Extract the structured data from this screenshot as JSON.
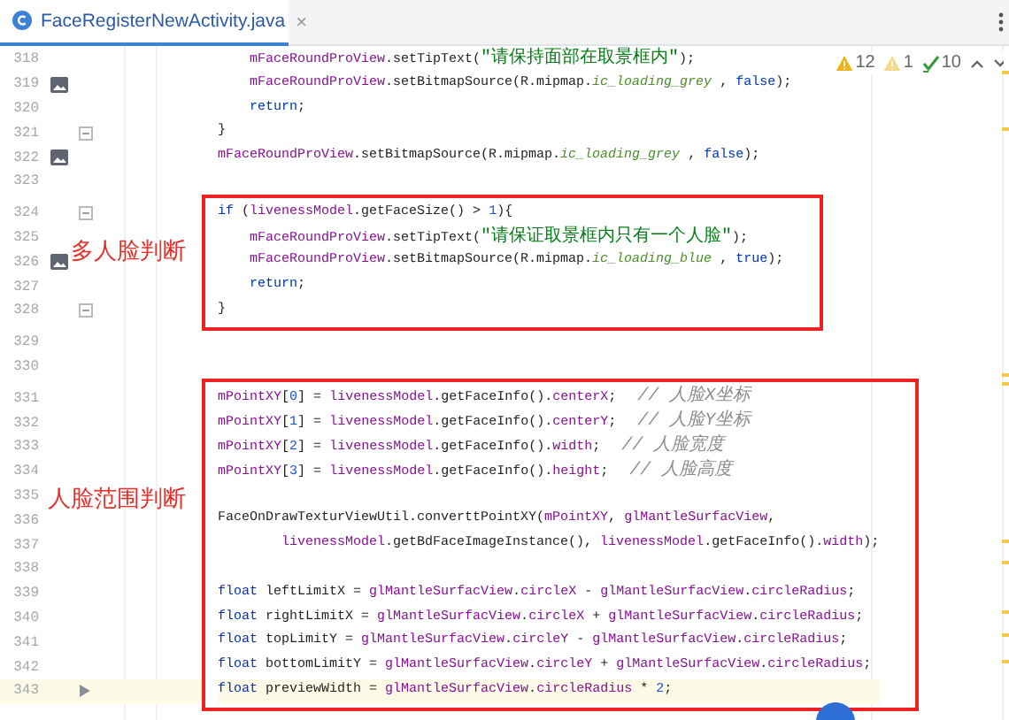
{
  "tab": {
    "title": "FaceRegisterNewActivity.java",
    "selected": true,
    "close": "×"
  },
  "inspections": [
    {
      "kind": "warning",
      "count": "12"
    },
    {
      "kind": "weak",
      "count": "1"
    },
    {
      "kind": "ok",
      "count": "10"
    }
  ],
  "blocks": [
    {
      "lines": [
        {
          "number": "318",
          "indented": true,
          "tokens": [
            {
              "kind": "field",
              "text": "mFaceRoundProView"
            },
            {
              "kind": "plain",
              "text": ".setTipText("
            },
            {
              "kind": "string",
              "text": "\"请保持面部在取景框内\""
            },
            {
              "kind": "plain",
              "text": ");"
            }
          ]
        },
        {
          "number": "319",
          "image_icon": true,
          "indented": true,
          "tokens": [
            {
              "kind": "field",
              "text": "mFaceRoundProView"
            },
            {
              "kind": "plain",
              "text": ".setBitmapSource(R.mipmap."
            },
            {
              "kind": "static",
              "text": "ic_loading_grey"
            },
            {
              "kind": "plain",
              "text": " , "
            },
            {
              "kind": "keyword",
              "text": "false"
            },
            {
              "kind": "plain",
              "text": ");"
            }
          ]
        },
        {
          "number": "320",
          "indented": true,
          "tokens": [
            {
              "kind": "keyword",
              "text": "return"
            },
            {
              "kind": "plain",
              "text": ";"
            }
          ]
        },
        {
          "number": "321",
          "fold": true,
          "tokens": [
            {
              "kind": "plain",
              "text": "}"
            }
          ]
        },
        {
          "number": "322",
          "image_icon": true,
          "tokens": [
            {
              "kind": "field",
              "text": "mFaceRoundProView"
            },
            {
              "kind": "plain",
              "text": ".setBitmapSource(R.mipmap."
            },
            {
              "kind": "static",
              "text": "ic_loading_grey"
            },
            {
              "kind": "plain",
              "text": " , "
            },
            {
              "kind": "keyword",
              "text": "false"
            },
            {
              "kind": "plain",
              "text": ");"
            }
          ]
        },
        {
          "number": "323"
        }
      ]
    },
    {
      "boxed": true,
      "note": "多人脸判断",
      "lines": [
        {
          "number": "324",
          "fold": true,
          "tokens": [
            {
              "kind": "keyword",
              "text": "if"
            },
            {
              "kind": "plain",
              "text": " ("
            },
            {
              "kind": "field",
              "text": "livenessModel"
            },
            {
              "kind": "plain",
              "text": ".getFaceSize() > "
            },
            {
              "kind": "number",
              "text": "1"
            },
            {
              "kind": "plain",
              "text": "){"
            }
          ]
        },
        {
          "number": "325",
          "indented": true,
          "tokens": [
            {
              "kind": "field",
              "text": "mFaceRoundProView"
            },
            {
              "kind": "plain",
              "text": ".setTipText("
            },
            {
              "kind": "string",
              "text": "\"请保证取景框内只有一个人脸\""
            },
            {
              "kind": "plain",
              "text": ");"
            }
          ]
        },
        {
          "number": "326",
          "image_icon": true,
          "indented": true,
          "tokens": [
            {
              "kind": "field",
              "text": "mFaceRoundProView"
            },
            {
              "kind": "plain",
              "text": ".setBitmapSource(R.mipmap."
            },
            {
              "kind": "static",
              "text": "ic_loading_blue"
            },
            {
              "kind": "plain",
              "text": " , "
            },
            {
              "kind": "keyword",
              "text": "true"
            },
            {
              "kind": "plain",
              "text": ");"
            }
          ]
        },
        {
          "number": "327",
          "indented": true,
          "tokens": [
            {
              "kind": "keyword",
              "text": "return"
            },
            {
              "kind": "plain",
              "text": ";"
            }
          ]
        },
        {
          "number": "328",
          "fold": true,
          "tokens": [
            {
              "kind": "plain",
              "text": "}"
            }
          ]
        }
      ]
    },
    {
      "lines": [
        {
          "number": "329"
        },
        {
          "number": "330"
        }
      ]
    },
    {
      "boxed": true,
      "note": "人脸范围判断",
      "lines": [
        {
          "number": "331",
          "tokens": [
            {
              "kind": "field",
              "text": "mPointXY"
            },
            {
              "kind": "plain",
              "text": "["
            },
            {
              "kind": "number",
              "text": "0"
            },
            {
              "kind": "plain",
              "text": "] = "
            },
            {
              "kind": "field",
              "text": "livenessModel"
            },
            {
              "kind": "plain",
              "text": ".getFaceInfo()."
            },
            {
              "kind": "field",
              "text": "centerX"
            },
            {
              "kind": "plain",
              "text": ";"
            },
            {
              "kind": "comment",
              "text": "// 人脸X坐标"
            }
          ]
        },
        {
          "number": "332",
          "tokens": [
            {
              "kind": "field",
              "text": "mPointXY"
            },
            {
              "kind": "plain",
              "text": "["
            },
            {
              "kind": "number",
              "text": "1"
            },
            {
              "kind": "plain",
              "text": "] = "
            },
            {
              "kind": "field",
              "text": "livenessModel"
            },
            {
              "kind": "plain",
              "text": ".getFaceInfo()."
            },
            {
              "kind": "field",
              "text": "centerY"
            },
            {
              "kind": "plain",
              "text": ";"
            },
            {
              "kind": "comment",
              "text": "// 人脸Y坐标"
            }
          ]
        },
        {
          "number": "333",
          "tokens": [
            {
              "kind": "field",
              "text": "mPointXY"
            },
            {
              "kind": "plain",
              "text": "["
            },
            {
              "kind": "number",
              "text": "2"
            },
            {
              "kind": "plain",
              "text": "] = "
            },
            {
              "kind": "field",
              "text": "livenessModel"
            },
            {
              "kind": "plain",
              "text": ".getFaceInfo()."
            },
            {
              "kind": "field",
              "text": "width"
            },
            {
              "kind": "plain",
              "text": ";"
            },
            {
              "kind": "comment",
              "text": "// 人脸宽度"
            }
          ]
        },
        {
          "number": "334",
          "tokens": [
            {
              "kind": "field",
              "text": "mPointXY"
            },
            {
              "kind": "plain",
              "text": "["
            },
            {
              "kind": "number",
              "text": "3"
            },
            {
              "kind": "plain",
              "text": "] = "
            },
            {
              "kind": "field",
              "text": "livenessModel"
            },
            {
              "kind": "plain",
              "text": ".getFaceInfo()."
            },
            {
              "kind": "field",
              "text": "height"
            },
            {
              "kind": "plain",
              "text": ";"
            },
            {
              "kind": "comment",
              "text": "// 人脸高度"
            }
          ]
        },
        {
          "number": "335"
        },
        {
          "number": "336",
          "tokens": [
            {
              "kind": "plain",
              "text": "FaceOnDrawTexturViewUtil.converttPointXY("
            },
            {
              "kind": "field",
              "text": "mPointXY"
            },
            {
              "kind": "plain",
              "text": ", "
            },
            {
              "kind": "field",
              "text": "glMantleSurfacView"
            },
            {
              "kind": "plain",
              "text": ","
            }
          ]
        },
        {
          "number": "337",
          "continuation": true,
          "tokens": [
            {
              "kind": "field",
              "text": "livenessModel"
            },
            {
              "kind": "plain",
              "text": ".getBdFaceImageInstance(), "
            },
            {
              "kind": "field",
              "text": "livenessModel"
            },
            {
              "kind": "plain",
              "text": ".getFaceInfo()."
            },
            {
              "kind": "field",
              "text": "width"
            },
            {
              "kind": "plain",
              "text": ");"
            }
          ]
        },
        {
          "number": "338"
        },
        {
          "number": "339",
          "tokens": [
            {
              "kind": "keyword",
              "text": "float"
            },
            {
              "kind": "plain",
              "text": " leftLimitX = "
            },
            {
              "kind": "field",
              "text": "glMantleSurfacView"
            },
            {
              "kind": "plain",
              "text": "."
            },
            {
              "kind": "field",
              "text": "circleX"
            },
            {
              "kind": "plain",
              "text": " - "
            },
            {
              "kind": "field",
              "text": "glMantleSurfacView"
            },
            {
              "kind": "plain",
              "text": "."
            },
            {
              "kind": "field",
              "text": "circleRadius"
            },
            {
              "kind": "plain",
              "text": ";"
            }
          ]
        },
        {
          "number": "340",
          "tokens": [
            {
              "kind": "keyword",
              "text": "float"
            },
            {
              "kind": "plain",
              "text": " rightLimitX = "
            },
            {
              "kind": "field",
              "text": "glMantleSurfacView"
            },
            {
              "kind": "plain",
              "text": "."
            },
            {
              "kind": "field",
              "text": "circleX"
            },
            {
              "kind": "plain",
              "text": " + "
            },
            {
              "kind": "field",
              "text": "glMantleSurfacView"
            },
            {
              "kind": "plain",
              "text": "."
            },
            {
              "kind": "field",
              "text": "circleRadius"
            },
            {
              "kind": "plain",
              "text": ";"
            }
          ]
        },
        {
          "number": "341",
          "tokens": [
            {
              "kind": "keyword",
              "text": "float"
            },
            {
              "kind": "plain",
              "text": " topLimitY = "
            },
            {
              "kind": "field",
              "text": "glMantleSurfacView"
            },
            {
              "kind": "plain",
              "text": "."
            },
            {
              "kind": "field",
              "text": "circleY"
            },
            {
              "kind": "plain",
              "text": " - "
            },
            {
              "kind": "field",
              "text": "glMantleSurfacView"
            },
            {
              "kind": "plain",
              "text": "."
            },
            {
              "kind": "field",
              "text": "circleRadius"
            },
            {
              "kind": "plain",
              "text": ";"
            }
          ]
        },
        {
          "number": "342",
          "tokens": [
            {
              "kind": "keyword",
              "text": "float"
            },
            {
              "kind": "plain",
              "text": " bottomLimitY = "
            },
            {
              "kind": "field",
              "text": "glMantleSurfacView"
            },
            {
              "kind": "plain",
              "text": "."
            },
            {
              "kind": "field",
              "text": "circleY"
            },
            {
              "kind": "plain",
              "text": " + "
            },
            {
              "kind": "field",
              "text": "glMantleSurfacView"
            },
            {
              "kind": "plain",
              "text": "."
            },
            {
              "kind": "field",
              "text": "circleRadius"
            },
            {
              "kind": "plain",
              "text": ";"
            }
          ]
        },
        {
          "number": "343",
          "run_arrow": true,
          "current": true,
          "tokens": [
            {
              "kind": "keyword",
              "text": "float"
            },
            {
              "kind": "plain",
              "text": " previewWidth = "
            },
            {
              "kind": "field",
              "text": "glMantleSurfacView"
            },
            {
              "kind": "plain",
              "text": "."
            },
            {
              "kind": "field",
              "text": "circleRadius"
            },
            {
              "kind": "plain",
              "text": " * "
            },
            {
              "kind": "number",
              "text": "2"
            },
            {
              "kind": "plain",
              "text": ";"
            }
          ]
        }
      ]
    }
  ]
}
